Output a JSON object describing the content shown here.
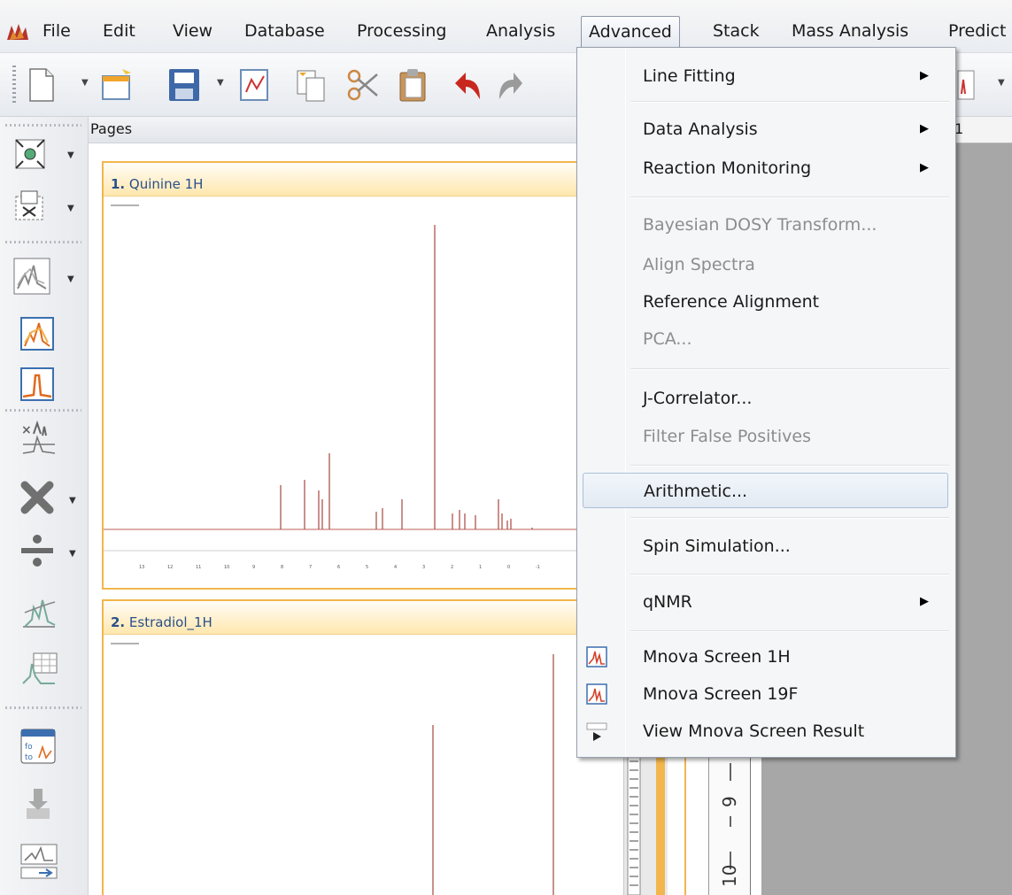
{
  "menubar": {
    "items": [
      "File",
      "Edit",
      "View",
      "Database",
      "Processing",
      "Analysis",
      "Advanced",
      "Stack",
      "Mass Analysis",
      "Predict"
    ]
  },
  "pages_panel": {
    "title": "Pages",
    "pages": [
      {
        "number": "1.",
        "title": "Quinine 1H"
      },
      {
        "number": "2.",
        "title": "Estradiol_1H"
      }
    ]
  },
  "top_ruler": {
    "label": "1"
  },
  "advanced_menu": {
    "items": [
      {
        "label": "Line Fitting",
        "submenu": true,
        "enabled": true
      },
      {
        "label": "Data Analysis",
        "submenu": true,
        "enabled": true
      },
      {
        "label": "Reaction Monitoring",
        "submenu": true,
        "enabled": true
      },
      {
        "label": "Bayesian DOSY Transform...",
        "submenu": false,
        "enabled": false
      },
      {
        "label": "Align Spectra",
        "submenu": false,
        "enabled": false
      },
      {
        "label": "Reference Alignment",
        "submenu": false,
        "enabled": true
      },
      {
        "label": "PCA...",
        "submenu": false,
        "enabled": false
      },
      {
        "label": "J-Correlator...",
        "submenu": false,
        "enabled": true
      },
      {
        "label": "Filter False Positives",
        "submenu": false,
        "enabled": false
      },
      {
        "label": "Arithmetic...",
        "submenu": false,
        "enabled": true,
        "highlighted": true
      },
      {
        "label": "Spin Simulation...",
        "submenu": false,
        "enabled": true
      },
      {
        "label": "qNMR",
        "submenu": true,
        "enabled": true
      },
      {
        "label": "Mnova Screen 1H",
        "submenu": false,
        "enabled": true,
        "icon": "spectrum-icon"
      },
      {
        "label": "Mnova Screen 19F",
        "submenu": false,
        "enabled": true,
        "icon": "spectrum-icon"
      },
      {
        "label": "View Mnova Screen Result",
        "submenu": false,
        "enabled": true,
        "icon": "view-result-icon"
      }
    ]
  },
  "colors": {
    "accent": "#f2b64d",
    "spectrum": "#b4625a",
    "menu_highlight": "#aac0da"
  }
}
